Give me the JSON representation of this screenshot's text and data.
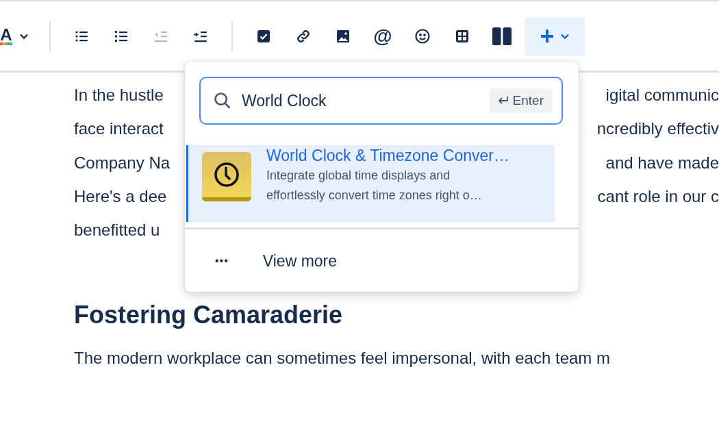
{
  "toolbar": {
    "tools": [
      {
        "kind": "text-color",
        "label": "A",
        "disabled": false
      },
      {
        "kind": "divider"
      },
      {
        "kind": "bullet-list",
        "disabled": false
      },
      {
        "kind": "numbered-list",
        "disabled": false
      },
      {
        "kind": "outdent",
        "disabled": true
      },
      {
        "kind": "indent",
        "disabled": false
      },
      {
        "kind": "divider"
      },
      {
        "kind": "task",
        "disabled": false
      },
      {
        "kind": "link",
        "disabled": false
      },
      {
        "kind": "image",
        "disabled": false
      },
      {
        "kind": "mention",
        "label": "@",
        "disabled": false
      },
      {
        "kind": "emoji",
        "disabled": false
      },
      {
        "kind": "table",
        "disabled": false
      },
      {
        "kind": "layout",
        "disabled": false
      },
      {
        "kind": "insert",
        "label": "+",
        "disabled": false,
        "expanded": true
      }
    ]
  },
  "document": {
    "lines": [
      {
        "left": "In the hustle",
        "right": "igital communic"
      },
      {
        "left": "face interact",
        "right": "ncredibly effectiv"
      },
      {
        "left": "Company Na",
        "right": "and have made"
      },
      {
        "left": "Here's a dee",
        "right": "cant role in our c"
      },
      {
        "left": "benefitted u"
      }
    ],
    "heading": "Fostering Camaraderie",
    "paragraph": "The modern workplace can sometimes feel impersonal, with each team m"
  },
  "insert_menu": {
    "search": {
      "value": "World Clock",
      "shortcut": "Enter"
    },
    "results": [
      {
        "title": "World Clock & Timezone Conver…",
        "description": "Integrate global time displays and effortlessly convert time zones right o…",
        "selected": true
      }
    ],
    "more": {
      "icon": "•••",
      "label": "View more"
    }
  }
}
